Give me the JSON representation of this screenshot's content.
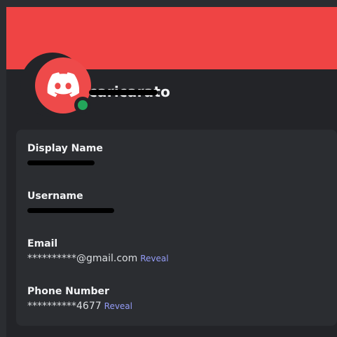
{
  "profile": {
    "username_header": "caricarato"
  },
  "fields": {
    "display_name": {
      "label": "Display Name",
      "value": ""
    },
    "username": {
      "label": "Username",
      "value": ""
    },
    "email": {
      "label": "Email",
      "value": "**********@gmail.com",
      "reveal": "Reveal"
    },
    "phone": {
      "label": "Phone Number",
      "value": "**********4677",
      "reveal": "Reveal"
    }
  },
  "colors": {
    "banner": "#ef4444",
    "status_online": "#23a55a",
    "link": "#949cf7"
  },
  "icons": {
    "avatar": "discord-logo-icon",
    "status": "online-status-icon"
  }
}
